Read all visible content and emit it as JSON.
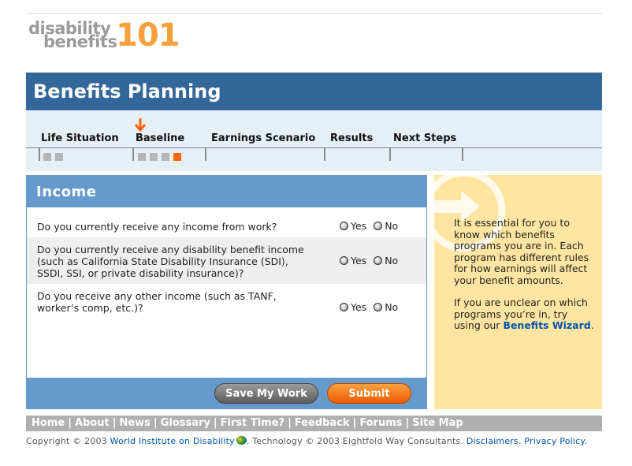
{
  "logo": {
    "word1": "disability",
    "word2": "benefits",
    "number": "101"
  },
  "page": {
    "title": "Benefits Planning"
  },
  "steps": [
    {
      "label": "Life Situation",
      "squares": 2,
      "active": -1
    },
    {
      "label": "Baseline",
      "squares": 4,
      "active": 3,
      "current": true
    },
    {
      "label": "Earnings Scenario"
    },
    {
      "label": "Results"
    },
    {
      "label": "Next Steps"
    }
  ],
  "income": {
    "heading": "Income",
    "questions": [
      {
        "text": "Do you currently receive any income from work?",
        "yes": "Yes",
        "no": "No"
      },
      {
        "text": "Do you currently receive any disability benefit income (such as California State Disability Insurance (SDI), SSDI, SSI, or private disability insurance)?",
        "yes": "Yes",
        "no": "No"
      },
      {
        "text": "Do you receive any other income (such as TANF, worker’s comp, etc.)?",
        "yes": "Yes",
        "no": "No"
      }
    ],
    "save_label": "Save My Work",
    "submit_label": "Submit"
  },
  "side": {
    "para1": "It is essential for you to know which  benefits programs you are in. Each program has different rules for how earnings will affect your benefit amounts.",
    "para2_prefix": "If you are unclear on which programs you’re in, try using our ",
    "para2_link": "Benefits Wizard",
    "para2_suffix": "."
  },
  "footer": {
    "nav": [
      "Home",
      "About",
      "News",
      "Glossary",
      "First Time?",
      "Feedback",
      "Forums",
      "Site Map"
    ],
    "copyright_prefix": "Copyright © 2003",
    "org_link": "World Institute on Disability",
    "tech_text": ". Technology © 2003 Eightfold Way Consultants.",
    "disclaimers": "Disclaimers.",
    "privacy": "Privacy Policy."
  },
  "colors": {
    "header_blue": "#336699",
    "panel_blue": "#6699cc",
    "accent_orange": "#ff6600",
    "note_yellow": "#ffe5a1"
  }
}
